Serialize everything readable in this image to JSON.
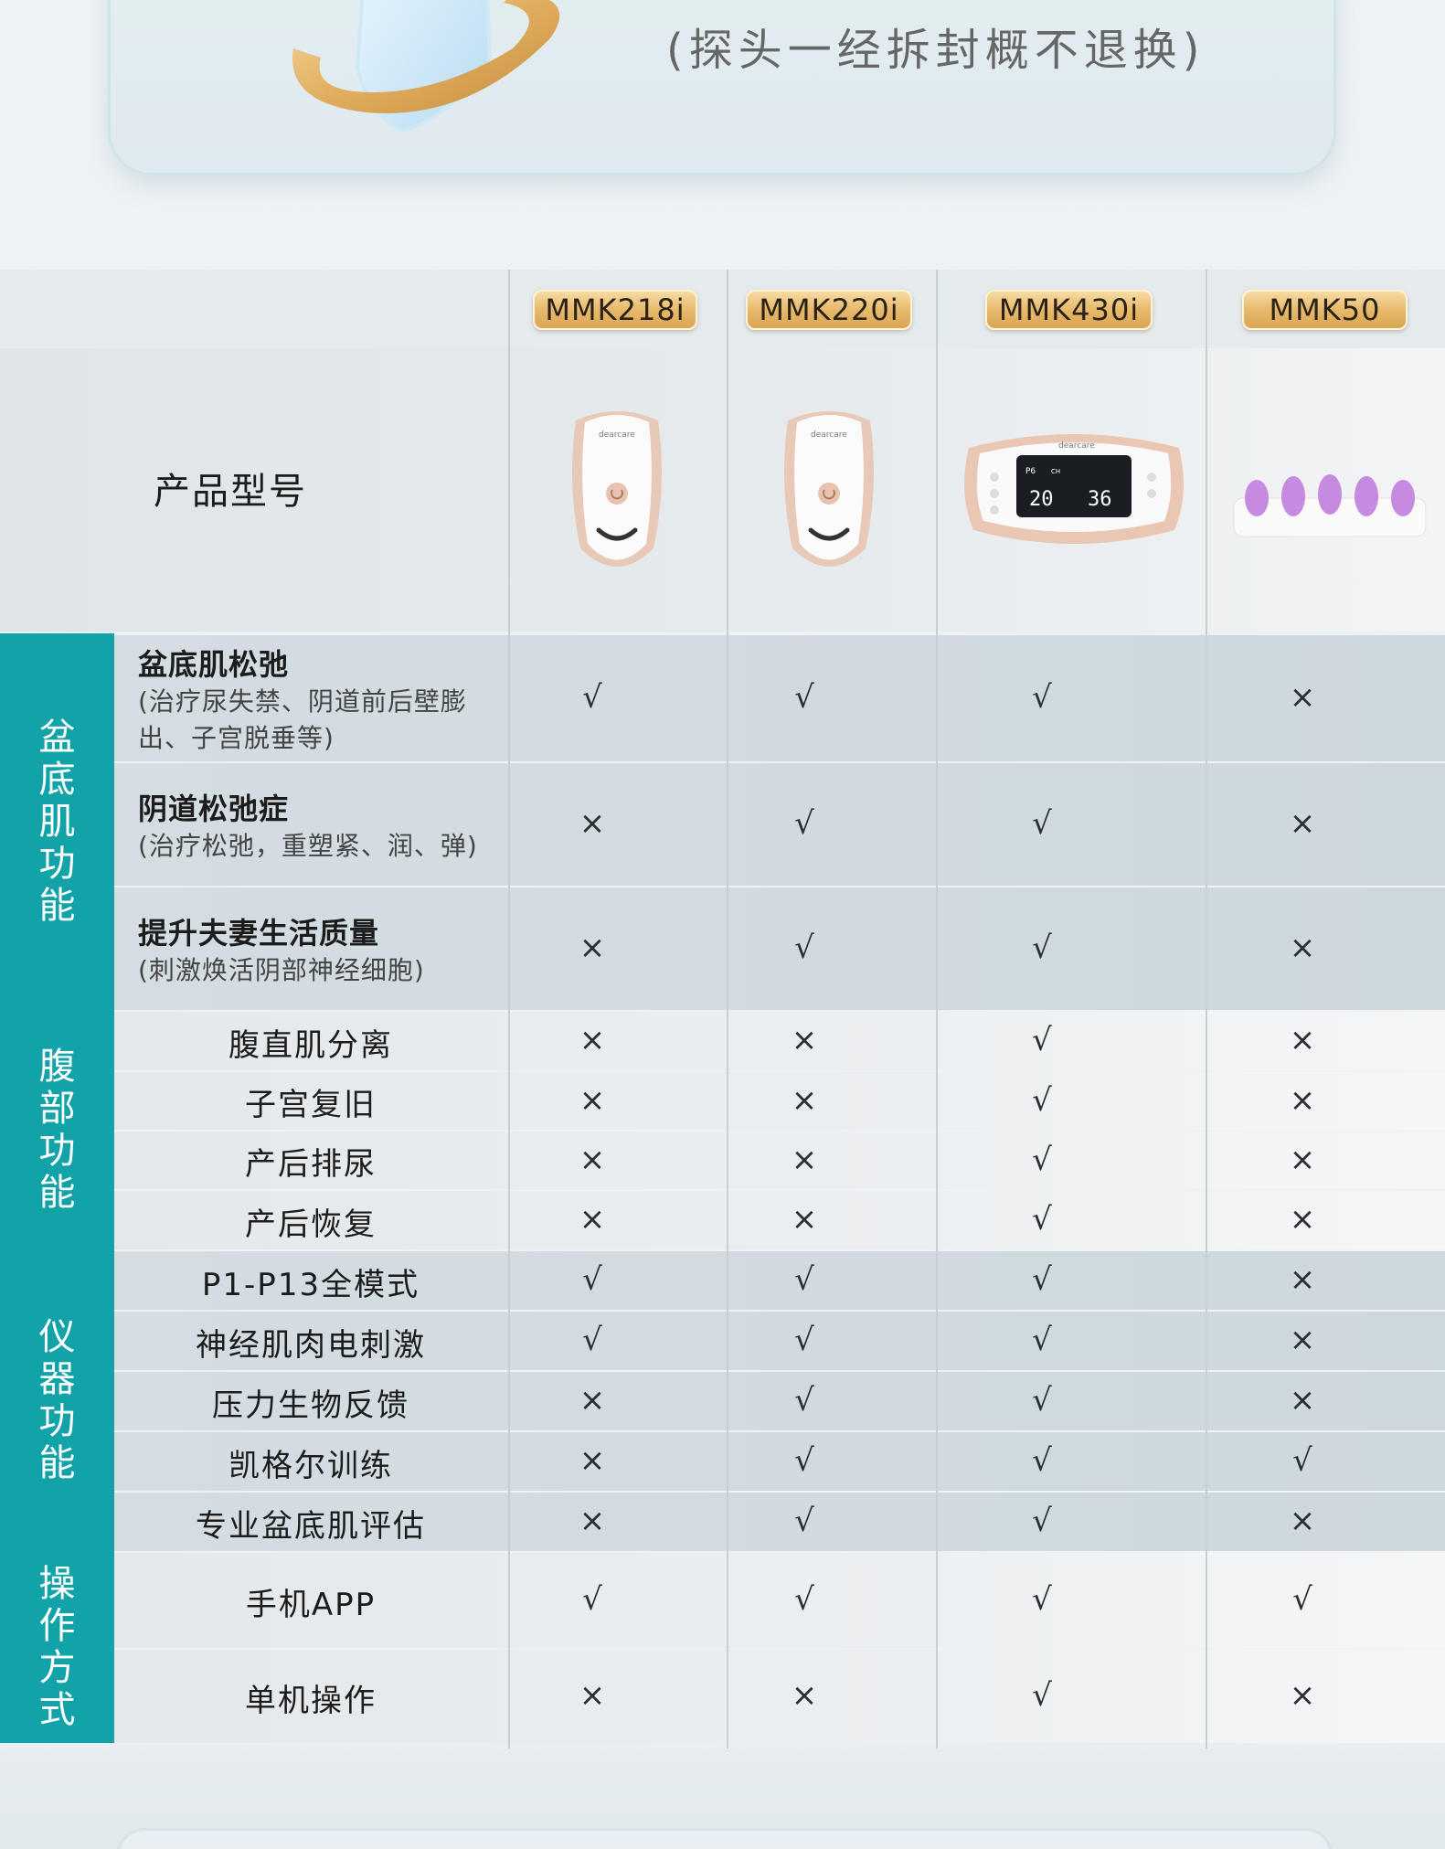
{
  "banner": {
    "title": "",
    "subtitle": "(探头一经拆封概不退换)"
  },
  "table": {
    "model_label": "产品型号",
    "models": [
      "MMK218i",
      "MMK220i",
      "MMK430i",
      "MMK50"
    ],
    "device_brand": "dearcare",
    "categories": [
      {
        "name": "盆底肌功能",
        "rows": [
          {
            "title": "盆底肌松弛",
            "desc": "(治疗尿失禁、阴道前后壁膨出、子宫脱垂等)",
            "marks": [
              "√",
              "√",
              "√",
              "×"
            ]
          },
          {
            "title": "阴道松弛症",
            "desc": "(治疗松弛，重塑紧、润、弹)",
            "marks": [
              "×",
              "√",
              "√",
              "×"
            ]
          },
          {
            "title": "提升夫妻生活质量",
            "desc": "(刺激焕活阴部神经细胞)",
            "marks": [
              "×",
              "√",
              "√",
              "×"
            ]
          }
        ]
      },
      {
        "name": "腹部功能",
        "rows": [
          {
            "title": "腹直肌分离",
            "marks": [
              "×",
              "×",
              "√",
              "×"
            ]
          },
          {
            "title": "子宫复旧",
            "marks": [
              "×",
              "×",
              "√",
              "×"
            ]
          },
          {
            "title": "产后排尿",
            "marks": [
              "×",
              "×",
              "√",
              "×"
            ]
          },
          {
            "title": "产后恢复",
            "marks": [
              "×",
              "×",
              "√",
              "×"
            ]
          }
        ]
      },
      {
        "name": "仪器功能",
        "rows": [
          {
            "title": "P1-P13全模式",
            "marks": [
              "√",
              "√",
              "√",
              "×"
            ]
          },
          {
            "title": "神经肌肉电刺激",
            "marks": [
              "√",
              "√",
              "√",
              "×"
            ]
          },
          {
            "title": "压力生物反馈",
            "marks": [
              "×",
              "√",
              "√",
              "×"
            ]
          },
          {
            "title": "凯格尔训练",
            "marks": [
              "×",
              "√",
              "√",
              "√"
            ]
          },
          {
            "title": "专业盆底肌评估",
            "marks": [
              "×",
              "√",
              "√",
              "×"
            ]
          }
        ]
      },
      {
        "name": "操作方式",
        "rows": [
          {
            "title": "手机APP",
            "marks": [
              "√",
              "√",
              "√",
              "√"
            ]
          },
          {
            "title": "单机操作",
            "marks": [
              "×",
              "×",
              "√",
              "×"
            ]
          }
        ]
      }
    ],
    "device_display": {
      "left": "20",
      "right": "36",
      "p": "P6",
      "ch": "CH"
    }
  },
  "colors": {
    "accent_teal": "#11a3a8",
    "badge_gold": "#e7b96b"
  }
}
